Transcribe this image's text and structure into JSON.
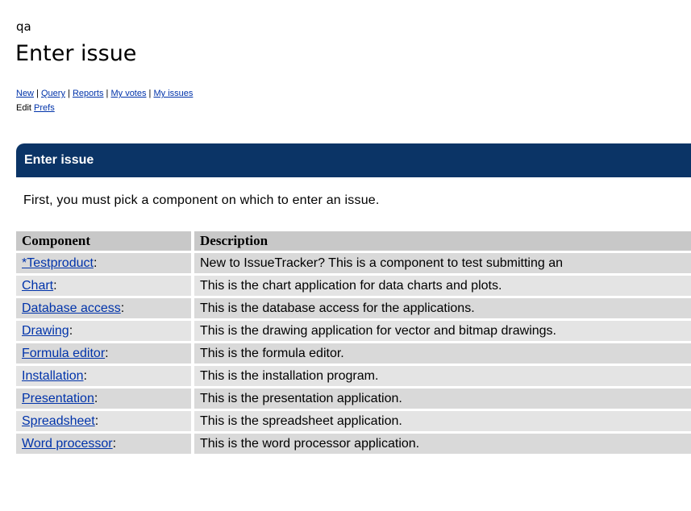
{
  "project": "qa",
  "page_title": "Enter issue",
  "nav": {
    "links": [
      "New",
      "Query",
      "Reports",
      "My votes",
      "My issues"
    ],
    "edit_text": "Edit",
    "prefs_link": "Prefs"
  },
  "panel": {
    "title": "Enter issue",
    "intro": "First, you must pick a component on which to enter an issue."
  },
  "table": {
    "headers": [
      "Component",
      "Description"
    ],
    "rows": [
      {
        "component": "*Testproduct",
        "description": "New to IssueTracker? This is a component to test submitting an"
      },
      {
        "component": "Chart",
        "description": "This is the chart application for data charts and plots."
      },
      {
        "component": "Database access",
        "description": "This is the database access for the applications."
      },
      {
        "component": "Drawing",
        "description": "This is the drawing application for vector and bitmap drawings."
      },
      {
        "component": "Formula editor",
        "description": "This is the formula editor."
      },
      {
        "component": "Installation",
        "description": "This is the installation program."
      },
      {
        "component": "Presentation",
        "description": "This is the presentation application."
      },
      {
        "component": "Spreadsheet",
        "description": "This is the spreadsheet application."
      },
      {
        "component": "Word processor",
        "description": "This is the word processor application."
      }
    ]
  }
}
